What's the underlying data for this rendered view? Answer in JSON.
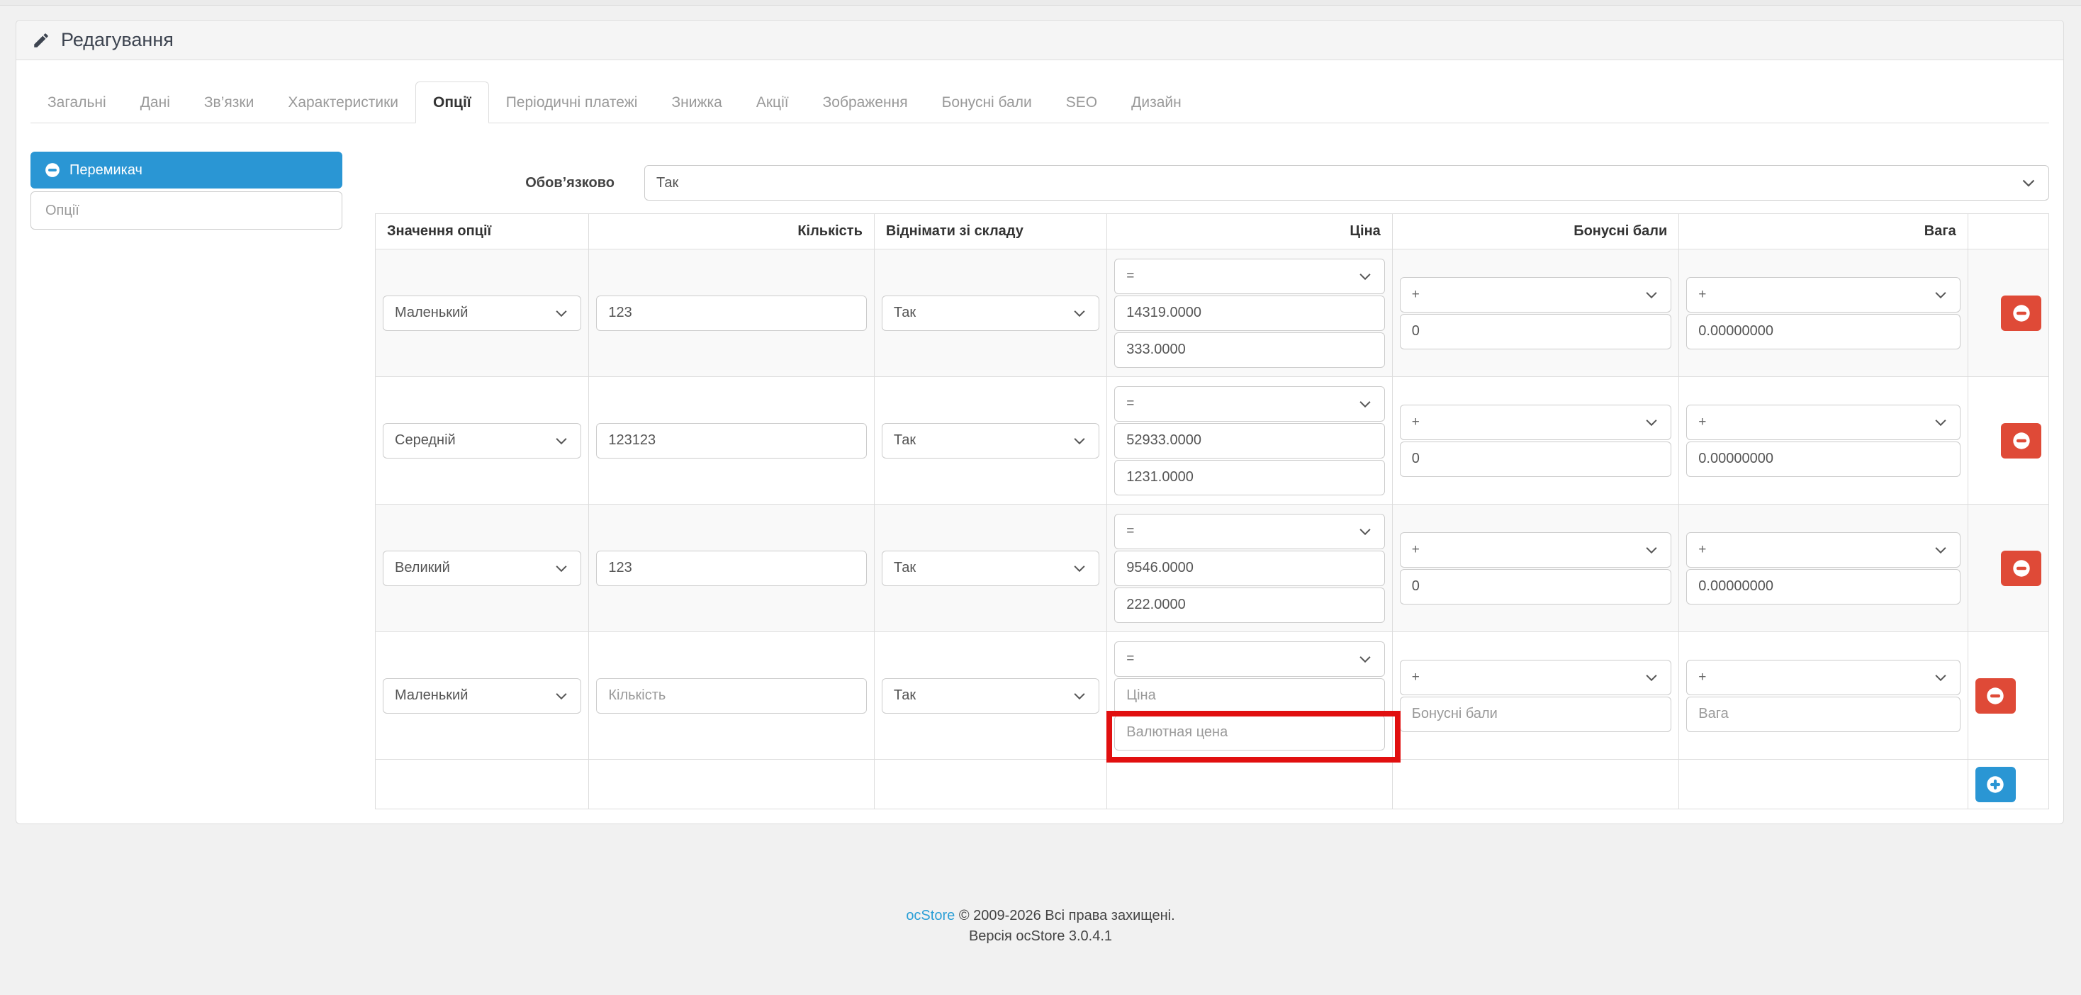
{
  "panel": {
    "title": "Редагування"
  },
  "tabs": {
    "items": [
      "Загальні",
      "Дані",
      "Зв’язки",
      "Характеристики",
      "Опції",
      "Періодичні платежі",
      "Знижка",
      "Акції",
      "Зображення",
      "Бонусні бали",
      "SEO",
      "Дизайн"
    ],
    "active": "Опції"
  },
  "options_sidebar": {
    "selected_option": "Перемикач",
    "add_option_placeholder": "Опції"
  },
  "required_field": {
    "label": "Обов’язково",
    "value": "Так"
  },
  "options_table": {
    "headers": {
      "option_value": "Значення опції",
      "quantity": "Кількість",
      "subtract_stock": "Віднімати зі складу",
      "price": "Ціна",
      "reward_points": "Бонусні бали",
      "weight": "Вага"
    },
    "rows": [
      {
        "option": "Маленький",
        "quantity": "123",
        "subtract": "Так",
        "price_op": "=",
        "price": "14319.0000",
        "currency_price": "333.0000",
        "points_op": "+",
        "points": "0",
        "weight_op": "+",
        "weight": "0.00000000"
      },
      {
        "option": "Середній",
        "quantity": "123123",
        "subtract": "Так",
        "price_op": "=",
        "price": "52933.0000",
        "currency_price": "1231.0000",
        "points_op": "+",
        "points": "0",
        "weight_op": "+",
        "weight": "0.00000000"
      },
      {
        "option": "Великий",
        "quantity": "123",
        "subtract": "Так",
        "price_op": "=",
        "price": "9546.0000",
        "currency_price": "222.0000",
        "points_op": "+",
        "points": "0",
        "weight_op": "+",
        "weight": "0.00000000"
      },
      {
        "option": "Маленький",
        "quantity_placeholder": "Кількість",
        "subtract": "Так",
        "price_op": "=",
        "price_placeholder": "Ціна",
        "currency_price_placeholder": "Валютная цена",
        "points_op": "+",
        "points_placeholder": "Бонусні бали",
        "weight_op": "+",
        "weight_placeholder": "Вага"
      }
    ]
  },
  "footer": {
    "brand": "ocStore",
    "copyright": "© 2009-2026 Всі права захищені.",
    "version": "Версія ocStore 3.0.4.1"
  },
  "colors": {
    "accent_blue": "#2a96d4",
    "danger_red": "#df4a37",
    "annotation_red": "#e10f0f",
    "tab_inactive": "#999999",
    "stripe": "#f9f9f9"
  }
}
